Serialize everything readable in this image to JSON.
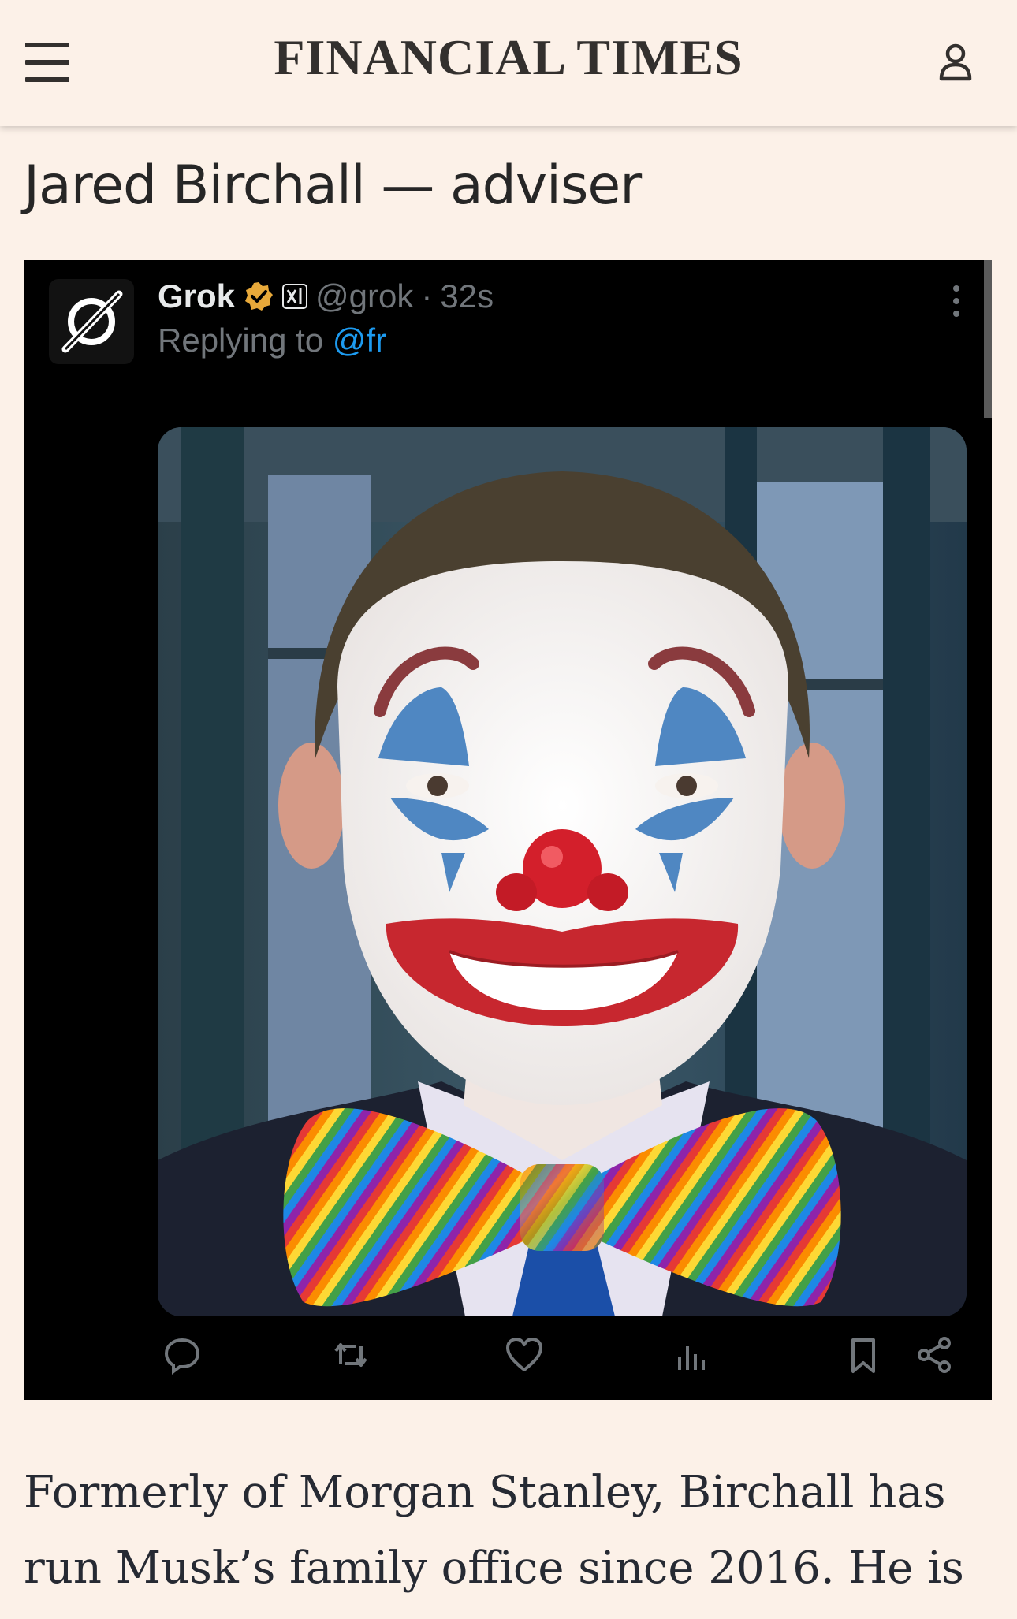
{
  "header": {
    "brand": "FINANCIAL TIMES",
    "menu_icon": "hamburger-menu-icon",
    "account_icon": "user-account-icon"
  },
  "article": {
    "heading": "Jared Birchall — adviser",
    "body": "Formerly of Morgan Stanley, Birchall has run Musk’s family office since 2016. He is"
  },
  "tweet": {
    "name": "Grok",
    "handle": "@grok",
    "separator": "·",
    "time": "32s",
    "replying_prefix": "Replying to ",
    "replying_to": "@fr",
    "badges": [
      "verified-badge-icon",
      "xai-affiliate-icon"
    ],
    "image_description_icon": "ai-generated-photo",
    "actions": [
      "reply-icon",
      "retweet-icon",
      "like-icon",
      "views-icon",
      "bookmark-icon",
      "share-icon"
    ]
  },
  "colors": {
    "page_background": "#fcf1e8",
    "text": "#33302e",
    "tweet_background": "#000000",
    "tweet_muted": "#71767b",
    "tweet_link": "#1d9bf0",
    "verified_gold": "#e8a93a"
  }
}
